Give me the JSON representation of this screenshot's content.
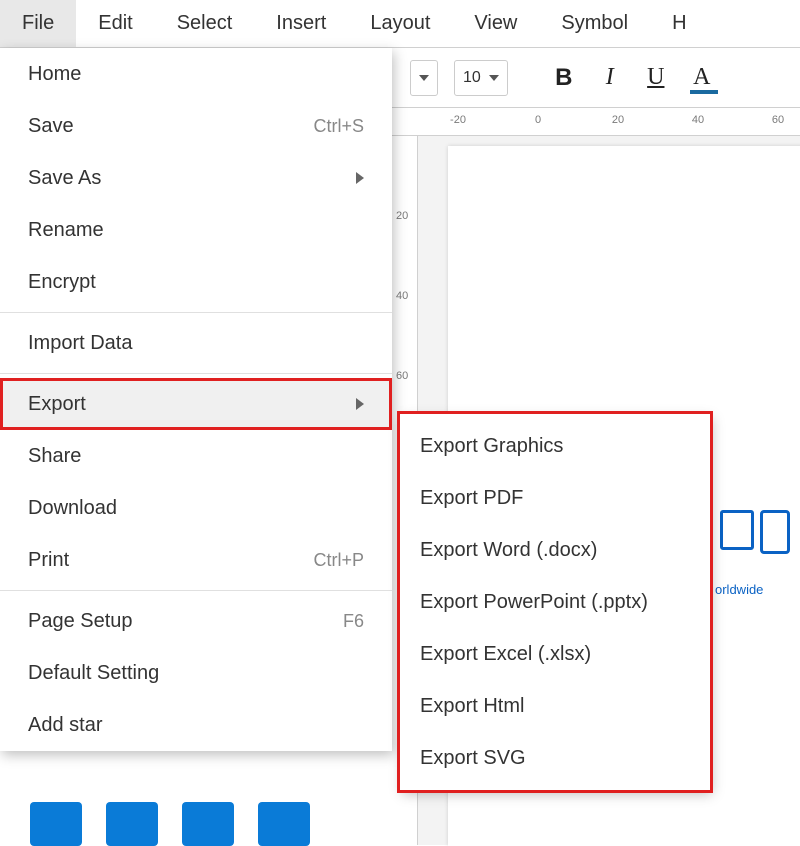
{
  "menubar": [
    "File",
    "Edit",
    "Select",
    "Insert",
    "Layout",
    "View",
    "Symbol",
    "H"
  ],
  "active_menu": "File",
  "toolbar": {
    "font_size": "10",
    "bold": "B",
    "italic": "I",
    "underline": "U",
    "color": "A"
  },
  "ruler_h": [
    "-20",
    "0",
    "20",
    "40",
    "60"
  ],
  "ruler_v": [
    "20",
    "40",
    "60"
  ],
  "file_menu": {
    "groups": [
      [
        {
          "label": "Home"
        },
        {
          "label": "Save",
          "shortcut": "Ctrl+S"
        },
        {
          "label": "Save As",
          "submenu": true
        },
        {
          "label": "Rename"
        },
        {
          "label": "Encrypt"
        }
      ],
      [
        {
          "label": "Import Data"
        }
      ],
      [
        {
          "label": "Export",
          "submenu": true,
          "highlighted": true,
          "boxed": true
        },
        {
          "label": "Share"
        },
        {
          "label": "Download"
        },
        {
          "label": "Print",
          "shortcut": "Ctrl+P"
        }
      ],
      [
        {
          "label": "Page Setup",
          "shortcut": "F6"
        },
        {
          "label": "Default Setting"
        },
        {
          "label": "Add star"
        }
      ]
    ]
  },
  "export_submenu": [
    "Export Graphics",
    "Export PDF",
    "Export Word (.docx)",
    "Export PowerPoint (.pptx)",
    "Export Excel (.xlsx)",
    "Export Html",
    "Export SVG"
  ],
  "canvas_caption": "orldwide"
}
